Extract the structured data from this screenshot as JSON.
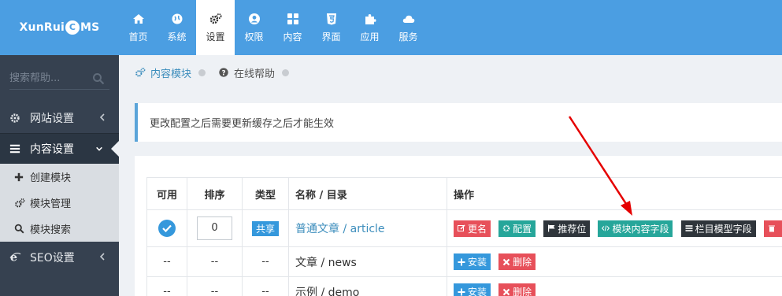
{
  "logo": {
    "pre": "XunRui",
    "mark": "C",
    "post": "MS"
  },
  "topnav": [
    {
      "label": "首页",
      "icon": "home-icon"
    },
    {
      "label": "系统",
      "icon": "globe-icon"
    },
    {
      "label": "设置",
      "icon": "cogs-icon",
      "active": true
    },
    {
      "label": "权限",
      "icon": "user-icon"
    },
    {
      "label": "内容",
      "icon": "grid-icon"
    },
    {
      "label": "界面",
      "icon": "html5-icon"
    },
    {
      "label": "应用",
      "icon": "puzzle-icon"
    },
    {
      "label": "服务",
      "icon": "cloud-icon"
    }
  ],
  "sidebar": {
    "search_placeholder": "搜索帮助...",
    "menu": [
      {
        "label": "网站设置",
        "icon": "gear-icon"
      },
      {
        "label": "内容设置",
        "icon": "bars-icon",
        "active": true
      },
      {
        "label": "SEO设置",
        "icon": "ie-icon"
      }
    ],
    "submenu": [
      {
        "label": "创建模块",
        "icon": "plus-icon"
      },
      {
        "label": "模块管理",
        "icon": "cogs-icon"
      },
      {
        "label": "模块搜索",
        "icon": "search-icon"
      }
    ]
  },
  "breadcrumb": [
    {
      "label": "内容模块",
      "icon": "cogs-icon"
    },
    {
      "label": "在线帮助",
      "icon": "question-circle-icon"
    }
  ],
  "notice": "更改配置之后需要更新缓存之后才能生效",
  "table": {
    "headers": [
      "可用",
      "排序",
      "类型",
      "名称 / 目录",
      "操作"
    ],
    "rows": [
      {
        "order": "0",
        "type": "共享",
        "name": "普通文章 / article",
        "actions": [
          "更名",
          "配置",
          "推荐位",
          "模块内容字段",
          "栏目模型字段"
        ]
      },
      {
        "enabled": "--",
        "order": "--",
        "type": "--",
        "name": "文章 / news",
        "actions": [
          "安装",
          "删除"
        ]
      },
      {
        "enabled": "--",
        "order": "--",
        "type": "--",
        "name": "示例 / demo",
        "actions": [
          "安装",
          "删除"
        ]
      }
    ]
  },
  "colors": {
    "topbar": "#4b9ee2",
    "sidebar": "#364150",
    "accent_red": "#e50000"
  }
}
